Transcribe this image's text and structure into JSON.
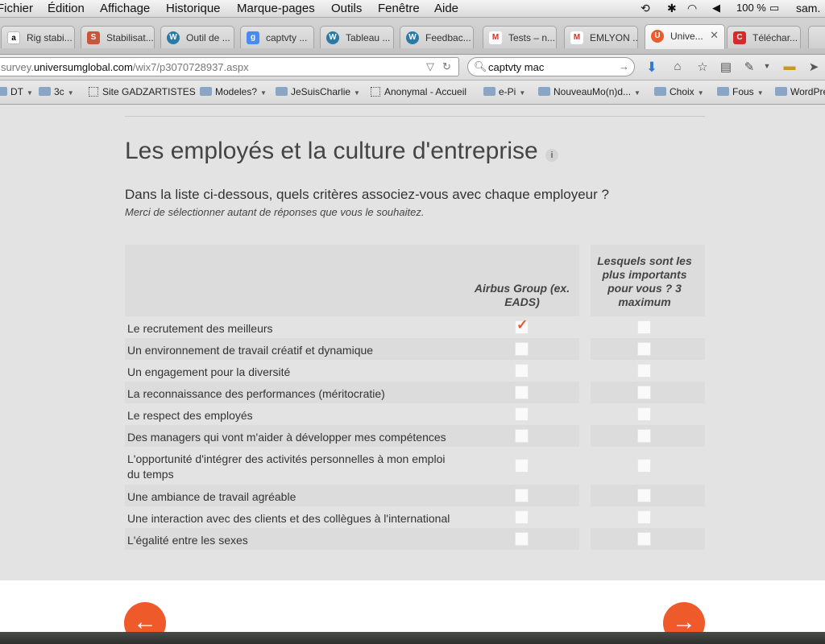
{
  "menubar": {
    "apple": "",
    "items": [
      "Fichier",
      "Édition",
      "Affichage",
      "Historique",
      "Marque-pages",
      "Outils",
      "Fenêtre",
      "Aide"
    ],
    "battery": "100 %",
    "clock": "sam."
  },
  "tabs": [
    {
      "title": "Rig stabi...",
      "icon": "amazon-icon"
    },
    {
      "title": "Stabilisat...",
      "icon": "stabilisateur-site-icon"
    },
    {
      "title": "Outil de ...",
      "icon": "wordpress-icon"
    },
    {
      "title": "captvty ...",
      "icon": "google-icon"
    },
    {
      "title": "Tableau ...",
      "icon": "wordpress-icon"
    },
    {
      "title": "Feedbac...",
      "icon": "wordpress-icon"
    },
    {
      "title": "Tests – n...",
      "icon": "gmail-icon"
    },
    {
      "title": "EMLYON ...",
      "icon": "gmail-icon"
    },
    {
      "title": "Unive...",
      "icon": "universum-icon",
      "active": true
    },
    {
      "title": "Téléchar...",
      "icon": "download-site-icon"
    }
  ],
  "urlbar": {
    "url_prefix": "survey.",
    "url_domain": "universumglobal.com",
    "url_path": "/wix7/p3070728937.aspx",
    "search_value": "captvty mac"
  },
  "bookmarks": [
    {
      "label": "DT",
      "type": "folder"
    },
    {
      "label": "3c",
      "type": "folder"
    },
    {
      "label": "Site GADZARTISTES",
      "type": "page"
    },
    {
      "label": "Modeles?",
      "type": "folder"
    },
    {
      "label": "JeSuisCharlie",
      "type": "folder"
    },
    {
      "label": "Anonymal - Accueil",
      "type": "page"
    },
    {
      "label": "e-Pi",
      "type": "folder"
    },
    {
      "label": "NouveauMo(n)d...",
      "type": "folder"
    },
    {
      "label": "Choix",
      "type": "folder"
    },
    {
      "label": "Fous",
      "type": "folder"
    },
    {
      "label": "WordPre",
      "type": "folder"
    }
  ],
  "survey": {
    "title": "Les employés et la culture d'entreprise",
    "info_icon": "i",
    "question": "Dans la liste ci-dessous, quels critères associez-vous avec chaque employeur ?",
    "hint": "Merci de sélectionner autant de réponses que vous le souhaitez.",
    "col1_header": "Airbus Group (ex. EADS)",
    "col2_header": "Lesquels sont les plus importants pour vous ? 3 maximum",
    "rows": [
      {
        "label": "Le recrutement des meilleurs",
        "col1_checked": true,
        "col2_checked": false
      },
      {
        "label": "Un environnement de travail créatif et dynamique",
        "col1_checked": false,
        "col2_checked": false
      },
      {
        "label": "Un engagement pour la diversité",
        "col1_checked": false,
        "col2_checked": false
      },
      {
        "label": "La reconnaissance des performances (méritocratie)",
        "col1_checked": false,
        "col2_checked": false
      },
      {
        "label": "Le respect des employés",
        "col1_checked": false,
        "col2_checked": false
      },
      {
        "label": "Des managers qui vont m'aider à développer mes compétences",
        "col1_checked": false,
        "col2_checked": false
      },
      {
        "label": "L'opportunité d'intégrer des activités personnelles à mon emploi du temps",
        "col1_checked": false,
        "col2_checked": false
      },
      {
        "label": "Une ambiance de travail agréable",
        "col1_checked": false,
        "col2_checked": false
      },
      {
        "label": "Une interaction avec des clients et des collègues à l'international",
        "col1_checked": false,
        "col2_checked": false
      },
      {
        "label": "L'égalité entre les sexes",
        "col1_checked": false,
        "col2_checked": false
      }
    ],
    "prev_icon": "arrow-left-icon",
    "next_icon": "arrow-right-icon"
  },
  "colors": {
    "accent": "#ef5a2a",
    "check": "#e05a3a",
    "page_bg": "#e3e3e3"
  }
}
